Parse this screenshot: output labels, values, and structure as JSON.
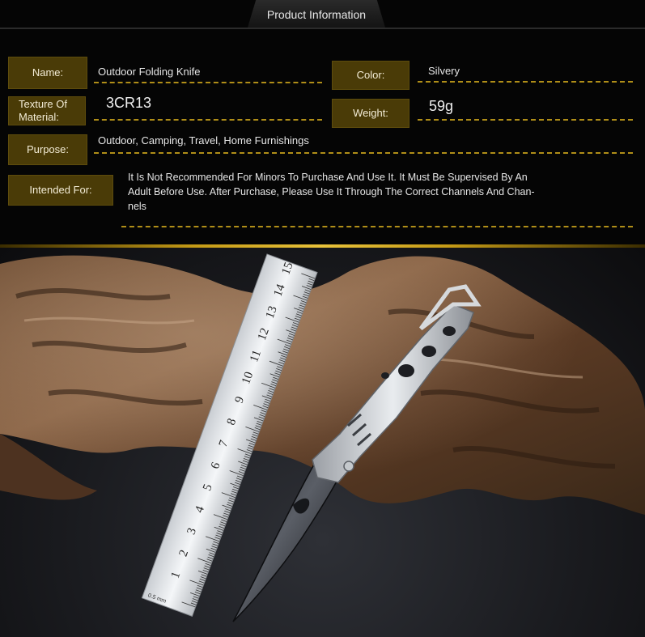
{
  "header": {
    "title": "Product Information"
  },
  "specs": {
    "name": {
      "label": "Name:",
      "value": "Outdoor Folding Knife"
    },
    "color": {
      "label": "Color:",
      "value": "Silvery"
    },
    "material": {
      "label": "Texture Of Material:",
      "value": "3CR13"
    },
    "weight": {
      "label": "Weight:",
      "value": "59g"
    },
    "purpose": {
      "label": "Purpose:",
      "value": "Outdoor, Camping, Travel, Home Furnishings"
    },
    "intended_for": {
      "label": "Intended For:",
      "value_line1": "It Is Not Recommended For Minors To Purchase And Use It. It Must Be Supervised By An",
      "value_line2": "Adult Before Use. After Purchase, Please Use It Through The Correct Channels And Chan-",
      "value_line3": "nels"
    }
  },
  "ruler": {
    "numbers": [
      "1",
      "2",
      "3",
      "4",
      "5",
      "6",
      "7",
      "8",
      "9",
      "10",
      "11",
      "12",
      "13",
      "14",
      "15"
    ],
    "mark_small": "0.5 mm"
  },
  "colors": {
    "accent_gold": "#b08e18",
    "label_bg": "#4a3b07",
    "background": "#050505"
  }
}
